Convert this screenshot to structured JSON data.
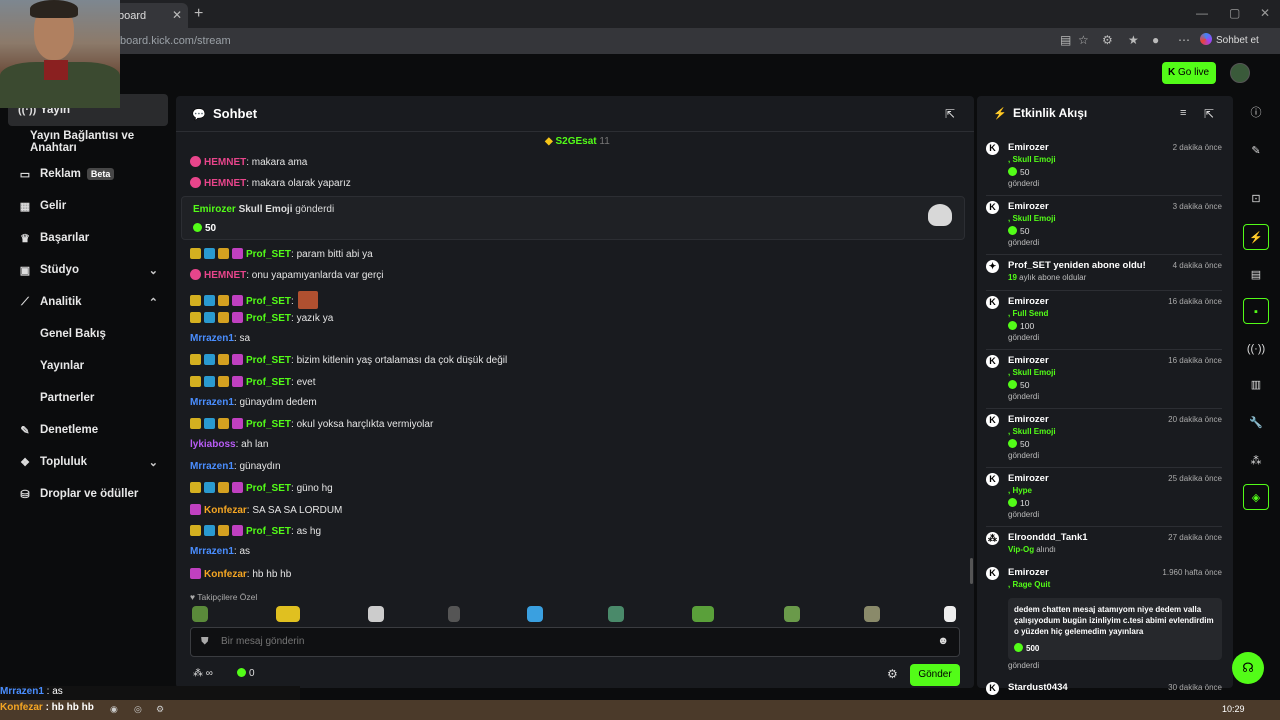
{
  "browser": {
    "tab_title": "board",
    "url": "board.kick.com/stream",
    "sohbet_et": "Sohbet et"
  },
  "topbar": {
    "go_live": "Go live"
  },
  "sidebar": {
    "items": [
      {
        "label": "Yayın",
        "icon": "broadcast-icon"
      },
      {
        "label": "Yayın Bağlantısı ve Anahtarı"
      },
      {
        "label": "Reklam",
        "badge": "Beta",
        "icon": "ad-icon"
      },
      {
        "label": "Gelir",
        "icon": "revenue-icon"
      },
      {
        "label": "Başarılar",
        "icon": "trophy-icon"
      },
      {
        "label": "Stüdyo",
        "icon": "studio-icon"
      },
      {
        "label": "Analitik",
        "icon": "analytics-icon"
      },
      {
        "label": "Genel Bakış"
      },
      {
        "label": "Yayınlar"
      },
      {
        "label": "Partnerler"
      },
      {
        "label": "Denetleme",
        "icon": "wrench-icon"
      },
      {
        "label": "Topluluk",
        "icon": "community-icon"
      },
      {
        "label": "Droplar ve ödüller",
        "icon": "drops-icon"
      }
    ]
  },
  "chat": {
    "title": "Sohbet",
    "pinned_user": "S2GEsat",
    "pinned_count": "11",
    "messages": [
      {
        "user": "HEMNET",
        "color": "#e8458b",
        "text": ": makara ama"
      },
      {
        "user": "HEMNET",
        "color": "#e8458b",
        "text": ": makara olarak yaparız"
      },
      {
        "user": "Prof_SET",
        "color": "#53fc18",
        "text": ": param bitti abi ya"
      },
      {
        "user": "HEMNET",
        "color": "#e8458b",
        "text": ": onu yapamıyanlarda var gerçi"
      },
      {
        "user": "Prof_SET",
        "color": "#53fc18",
        "text": ":"
      },
      {
        "user": "Prof_SET",
        "color": "#53fc18",
        "text": ": yazık ya"
      },
      {
        "user": "Mrrazen1",
        "color": "#4a8eff",
        "text": ": sa"
      },
      {
        "user": "Prof_SET",
        "color": "#53fc18",
        "text": ": bizim kitlenin yaş ortalaması da çok düşük değil"
      },
      {
        "user": "Prof_SET",
        "color": "#53fc18",
        "text": ": evet"
      },
      {
        "user": "Mrrazen1",
        "color": "#4a8eff",
        "text": ": günaydım dedem"
      },
      {
        "user": "Prof_SET",
        "color": "#53fc18",
        "text": ": okul yoksa harçlıkta vermiyolar"
      },
      {
        "user": "lykiaboss",
        "color": "#b85cf5",
        "text": ": ah lan"
      },
      {
        "user": "Mrrazen1",
        "color": "#4a8eff",
        "text": ": günaydın"
      },
      {
        "user": "Prof_SET",
        "color": "#53fc18",
        "text": ": güno hg"
      },
      {
        "user": "Konfezar",
        "color": "#f5a623",
        "text": ": SA SA SA LORDUM"
      },
      {
        "user": "Prof_SET",
        "color": "#53fc18",
        "text": ": as hg"
      },
      {
        "user": "Mrrazen1",
        "color": "#4a8eff",
        "text": ": as"
      },
      {
        "user": "Konfezar",
        "color": "#f5a623",
        "text": ": hb hb hb"
      }
    ],
    "gift": {
      "user": "Emirozer",
      "item": "Skull Emoji",
      "verb": "gönderdi",
      "amount": "50"
    },
    "emote_label": "Takipçilere Özel",
    "input_placeholder": "Bir mesaj gönderin",
    "send_label": "Gönder",
    "points": "∞",
    "kicks": "0"
  },
  "activity": {
    "title": "Etkinlik Akışı",
    "events": [
      {
        "name": "Emirozer",
        "item": ", Skull Emoji",
        "amount": "50",
        "sent": "gönderdi",
        "time": "2 dakika önce"
      },
      {
        "name": "Emirozer",
        "item": ", Skull Emoji",
        "amount": "50",
        "sent": "gönderdi",
        "time": "3 dakika önce"
      },
      {
        "name": "Prof_SET yeniden abone oldu!",
        "sub": "19",
        "sub_text": " aylık abone oldular",
        "time": "4 dakika önce"
      },
      {
        "name": "Emirozer",
        "item": ", Full Send",
        "amount": "100",
        "sent": "gönderdi",
        "time": "16 dakika önce"
      },
      {
        "name": "Emirozer",
        "item": ", Skull Emoji",
        "amount": "50",
        "sent": "gönderdi",
        "time": "16 dakika önce"
      },
      {
        "name": "Emirozer",
        "item": ", Skull Emoji",
        "amount": "50",
        "sent": "gönderdi",
        "time": "20 dakika önce"
      },
      {
        "name": "Emirozer",
        "item": ", Hype",
        "amount": "10",
        "sent": "gönderdi",
        "time": "25 dakika önce"
      },
      {
        "name": "Elroonddd_Tank1",
        "item": "Vip-Og",
        "item_suffix": " alındı",
        "time": "27 dakika önce"
      },
      {
        "name": "Emirozer",
        "item": ", Rage Quit",
        "time": "1.960 hafta önce",
        "note": "dedem chatten mesaj atamıyom niye dedem valla çalışıyodum bugün izinliyim c.tesi abimi evlendirdim o yüzden hiç gelemedim yayınlara",
        "amount": "500",
        "sent": "gönderdi"
      },
      {
        "name": "Stardust0434",
        "time": "30 dakika önce"
      }
    ]
  },
  "overlay": {
    "line1_user": "Mrrazen1",
    "line1_text": " : as",
    "line2_user": "Konfezar",
    "line2_text": " : hb hb hb"
  },
  "taskbar": {
    "clock": "10:29"
  }
}
